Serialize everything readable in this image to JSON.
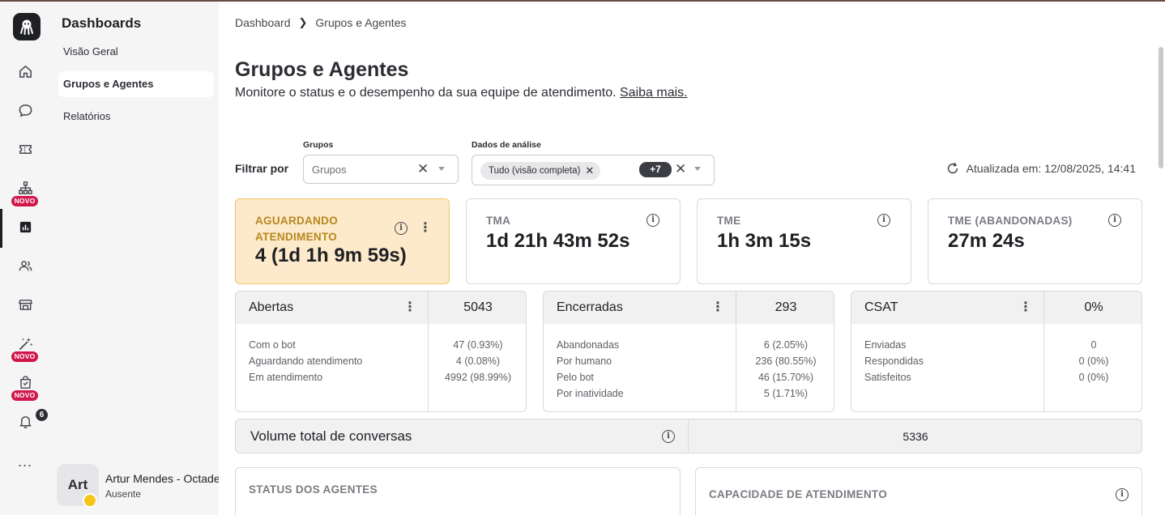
{
  "sidebar": {
    "title": "Dashboards",
    "items": [
      {
        "label": "Visão Geral"
      },
      {
        "label": "Grupos e Agentes"
      },
      {
        "label": "Relatórios"
      }
    ]
  },
  "rail": {
    "new_badge": "NOVO",
    "notifications_count": "6",
    "more": "..."
  },
  "user": {
    "initials": "Art",
    "name": "Artur Mendes - Octadesk",
    "status": "Ausente"
  },
  "breadcrumb": [
    "Dashboard",
    "Grupos e Agentes"
  ],
  "header": {
    "title": "Grupos e Agentes",
    "subtitle": "Monitore o status e o desempenho da sua equipe de atendimento.",
    "learn_more": "Saiba mais."
  },
  "filters": {
    "label": "Filtrar por",
    "groups": {
      "label": "Grupos",
      "placeholder": "Grupos"
    },
    "analysis": {
      "label": "Dados de análise",
      "chip": "Tudo (visão completa)",
      "more_count": "+7"
    },
    "updated": "Atualizada em: 12/08/2025, 14:41"
  },
  "kpis": [
    {
      "label": "AGUARDANDO ATENDIMENTO",
      "value": "4 (1d 1h 9m 59s)"
    },
    {
      "label": "TMA",
      "value": "1d 21h 43m 52s"
    },
    {
      "label": "TME",
      "value": "1h 3m 15s"
    },
    {
      "label": "TME (ABANDONADAS)",
      "value": "27m 24s"
    }
  ],
  "panels": [
    {
      "title": "Abertas",
      "total": "5043",
      "rows": [
        {
          "label": "Com o bot",
          "value": "47 (0.93%)"
        },
        {
          "label": "Aguardando atendimento",
          "value": "4 (0.08%)"
        },
        {
          "label": "Em atendimento",
          "value": "4992 (98.99%)"
        }
      ]
    },
    {
      "title": "Encerradas",
      "total": "293",
      "rows": [
        {
          "label": "Abandonadas",
          "value": "6 (2.05%)"
        },
        {
          "label": "Por humano",
          "value": "236 (80.55%)"
        },
        {
          "label": "Pelo bot",
          "value": "46 (15.70%)"
        },
        {
          "label": "Por inatividade",
          "value": "5 (1.71%)"
        }
      ]
    },
    {
      "title": "CSAT",
      "total": "0%",
      "rows": [
        {
          "label": "Enviadas",
          "value": "0"
        },
        {
          "label": "Respondidas",
          "value": "0 (0%)"
        },
        {
          "label": "Satisfeitos",
          "value": "0 (0%)"
        }
      ]
    }
  ],
  "volume": {
    "label": "Volume total de conversas",
    "value": "5336"
  },
  "sections": {
    "agents_status": "STATUS DOS AGENTES",
    "capacity": "CAPACIDADE DE ATENDIMENTO"
  }
}
